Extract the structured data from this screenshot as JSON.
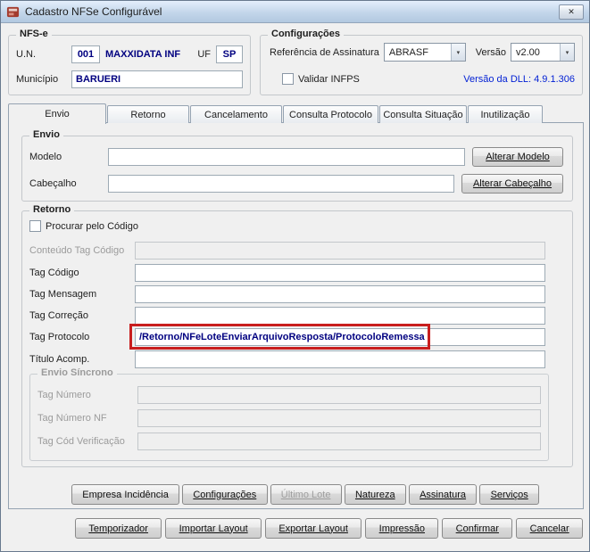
{
  "window": {
    "title": "Cadastro NFSe Configurável",
    "close_glyph": "✕"
  },
  "nfse": {
    "title": "NFS-e",
    "un_label": "U.N.",
    "un_value": "001",
    "company": "MAXXIDATA INF",
    "uf_label": "UF",
    "uf_value": "SP",
    "municipio_label": "Município",
    "municipio_value": "BARUERI"
  },
  "config": {
    "title": "Configurações",
    "ref_label": "Referência de Assinatura",
    "ref_value": "ABRASF",
    "versao_label": "Versão",
    "versao_value": "v2.00",
    "validar_label": "Validar INFPS",
    "dll_text": "Versão da DLL: 4.9.1.306",
    "chevron": "▾"
  },
  "tabs": [
    "Envio",
    "Retorno",
    "Cancelamento",
    "Consulta Protocolo",
    "Consulta Situação",
    "Inutilização"
  ],
  "envio": {
    "title": "Envio",
    "modelo_label": "Modelo",
    "modelo_value": "",
    "alterar_modelo": "Alterar Modelo",
    "cabecalho_label": "Cabeçalho",
    "cabecalho_value": "",
    "alterar_cabecalho": "Alterar Cabeçalho"
  },
  "retorno": {
    "title": "Retorno",
    "procurar_label": "Procurar pelo Código",
    "conteudo_label": "Conteúdo Tag Código",
    "conteudo_value": "",
    "tag_codigo_label": "Tag Código",
    "tag_codigo_value": "",
    "tag_mensagem_label": "Tag Mensagem",
    "tag_mensagem_value": "",
    "tag_correcao_label": "Tag Correção",
    "tag_correcao_value": "",
    "tag_protocolo_label": "Tag Protocolo",
    "tag_protocolo_value": "/Retorno/NFeLoteEnviarArquivoResposta/ProtocoloRemessa",
    "titulo_label": "Título Acomp.",
    "titulo_value": ""
  },
  "envio_sincrono": {
    "title": "Envio Síncrono",
    "tag_numero_label": "Tag Número",
    "tag_numero_nf_label": "Tag Número NF",
    "tag_cod_verificacao_label": "Tag Cód Verificação"
  },
  "buttons": {
    "row1": [
      "Empresa Incidência",
      "Configurações",
      "Último Lote",
      "Natureza",
      "Assinatura",
      "Serviços"
    ],
    "row2": [
      "Temporizador",
      "Importar Layout",
      "Exportar Layout",
      "Impressão",
      "Confirmar",
      "Cancelar"
    ]
  },
  "colors": {
    "value_text": "#000080",
    "dll_link": "#001fd4",
    "annotation": "#c81e1e"
  }
}
